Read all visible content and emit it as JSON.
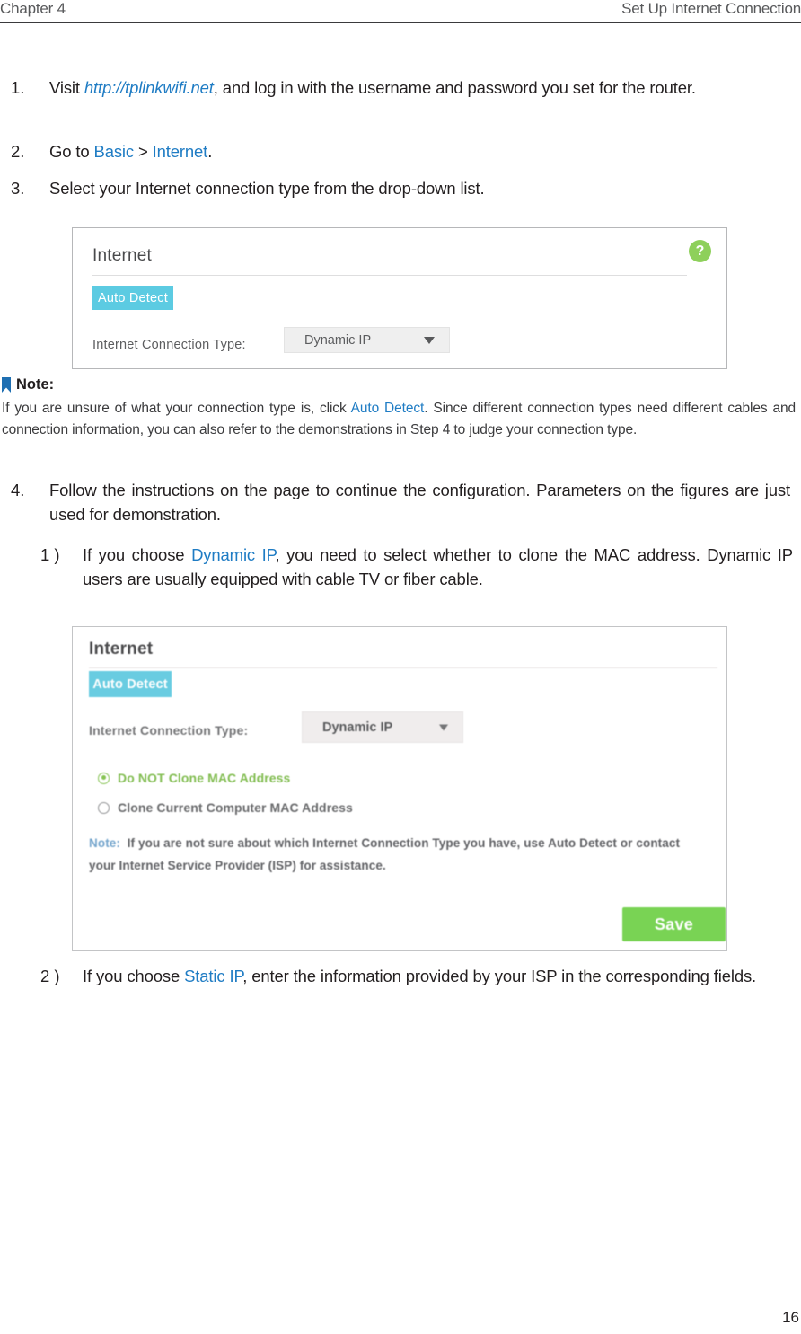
{
  "header": {
    "chapter": "Chapter 4",
    "section": "Set Up Internet Connection"
  },
  "steps": [
    {
      "num": "1.",
      "text_before": "Visit ",
      "link": "http://tplinkwifi.net",
      "text_after": ", and log in with the username and password you set for the router."
    },
    {
      "num": "2.",
      "prefix": "Go to ",
      "link1": "Basic",
      "sep": " > ",
      "link2": "Internet",
      "suffix": "."
    },
    {
      "num": "3.",
      "text": "Select your Internet connection type from the drop-down list."
    },
    {
      "num": "4.",
      "text": "Follow the instructions on the page to continue the configuration. Parameters on the figures are just used for demonstration."
    }
  ],
  "substeps": [
    {
      "num": "1 )",
      "text_before": "If you choose ",
      "link": "Dynamic IP",
      "text_after": ", you need to select whether to clone the MAC address. Dynamic IP users are usually equipped with cable TV or fiber cable."
    },
    {
      "num": "2 )",
      "text_before": "If you choose ",
      "link": "Static IP",
      "text_after": ", enter the information provided by your ISP in the corresponding fields."
    }
  ],
  "note": {
    "icon": "bookmark-flag-icon",
    "label": "Note:",
    "body_before": "If you are unsure of what your connection type is, click ",
    "body_link": "Auto Detect",
    "body_after": ". Since different connection types need different cables and connection information, you can also refer to the demonstrations in Step 4 to judge your connection type."
  },
  "figure1": {
    "title": "Internet",
    "help_icon": "question-mark-icon",
    "help_label": "?",
    "auto_detect": "Auto Detect",
    "connection_type_label": "Internet Connection Type:",
    "connection_type_value": "Dynamic IP",
    "caret_icon": "chevron-down-icon"
  },
  "figure2": {
    "title": "Internet",
    "auto_detect": "Auto Detect",
    "connection_type_label": "Internet Connection Type:",
    "connection_type_value": "Dynamic IP",
    "caret_icon": "chevron-down-icon",
    "radio_selected": "Do NOT Clone MAC Address",
    "radio_unselected": "Clone Current Computer MAC Address",
    "note_lead": "Note:",
    "note_text": "If you are not sure about which Internet Connection Type you have, use Auto Detect or contact your Internet Service Provider (ISP) for assistance.",
    "save": "Save"
  },
  "colors": {
    "link_blue": "#1f7cc4",
    "accent_cyan": "#5ccbe2",
    "accent_green": "#6fd048",
    "help_green": "#8ed05b",
    "radio_green": "#7dbf47"
  },
  "page_number": "16"
}
